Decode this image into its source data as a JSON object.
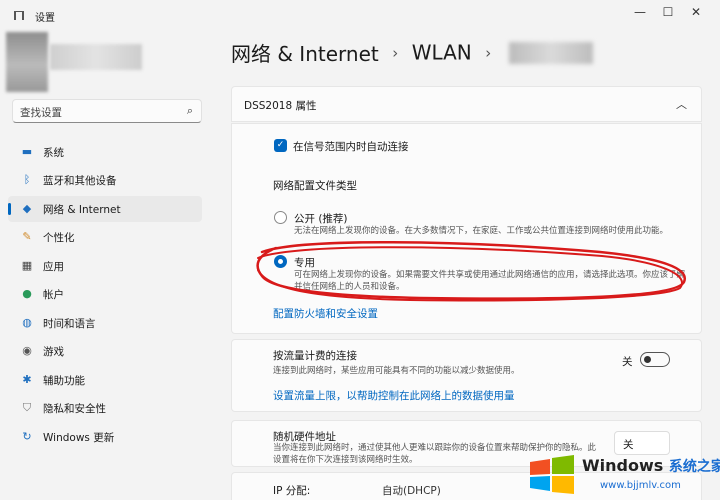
{
  "window": {
    "title": "设置",
    "controls": {
      "minimize": "—",
      "maximize": "☐",
      "close": "✕"
    }
  },
  "search": {
    "placeholder": "查找设置"
  },
  "sidebar": {
    "items": [
      {
        "label": "系统",
        "icon": "system-icon"
      },
      {
        "label": "蓝牙和其他设备",
        "icon": "bluetooth-icon"
      },
      {
        "label": "网络 & Internet",
        "icon": "wifi-icon",
        "active": true
      },
      {
        "label": "个性化",
        "icon": "brush-icon"
      },
      {
        "label": "应用",
        "icon": "apps-icon"
      },
      {
        "label": "帐户",
        "icon": "account-icon"
      },
      {
        "label": "时间和语言",
        "icon": "globe-icon"
      },
      {
        "label": "游戏",
        "icon": "gamepad-icon"
      },
      {
        "label": "辅助功能",
        "icon": "accessibility-icon"
      },
      {
        "label": "隐私和安全性",
        "icon": "shield-icon"
      },
      {
        "label": "Windows 更新",
        "icon": "update-icon"
      }
    ]
  },
  "breadcrumb": {
    "part1": "网络 & Internet",
    "sep": "›",
    "part2": "WLAN"
  },
  "properties": {
    "title": "DSS2018 属性",
    "auto_connect_label": "在信号范围内时自动连接",
    "auto_connect_checked": true,
    "profile_type_label": "网络配置文件类型",
    "public_title": "公开 (推荐)",
    "public_desc": "无法在网络上发现你的设备。在大多数情况下，在家庭、工作或公共位置连接到网络时使用此功能。",
    "private_title": "专用",
    "private_desc": "可在网络上发现你的设备。如果需要文件共享或使用通过此网络通信的应用，请选择此选项。你应该了解并信任网络上的人员和设备。",
    "firewall_link": "配置防火墙和安全设置"
  },
  "metered": {
    "title": "按流量计费的连接",
    "desc": "连接到此网络时，某些应用可能具有不同的功能以减少数据使用。",
    "toggle_label": "关",
    "toggle_on": false,
    "data_limit_link": "设置流量上限，以帮助控制在此网络上的数据使用量"
  },
  "random_hw": {
    "title": "随机硬件地址",
    "desc": "当你连接到此网络时，通过使其他人更难以跟踪你的设备位置来帮助保护你的隐私。此设置将在你下次连接到该网络时生效。",
    "select_value": "关"
  },
  "ip": {
    "label": "IP 分配:",
    "value": "自动(DHCP)"
  },
  "watermark": {
    "brand": "Windows",
    "cn": "系统之家",
    "url": "www.bjjmlv.com"
  },
  "colors": {
    "accent": "#0067c0",
    "annotation_red": "#d81a1a"
  }
}
